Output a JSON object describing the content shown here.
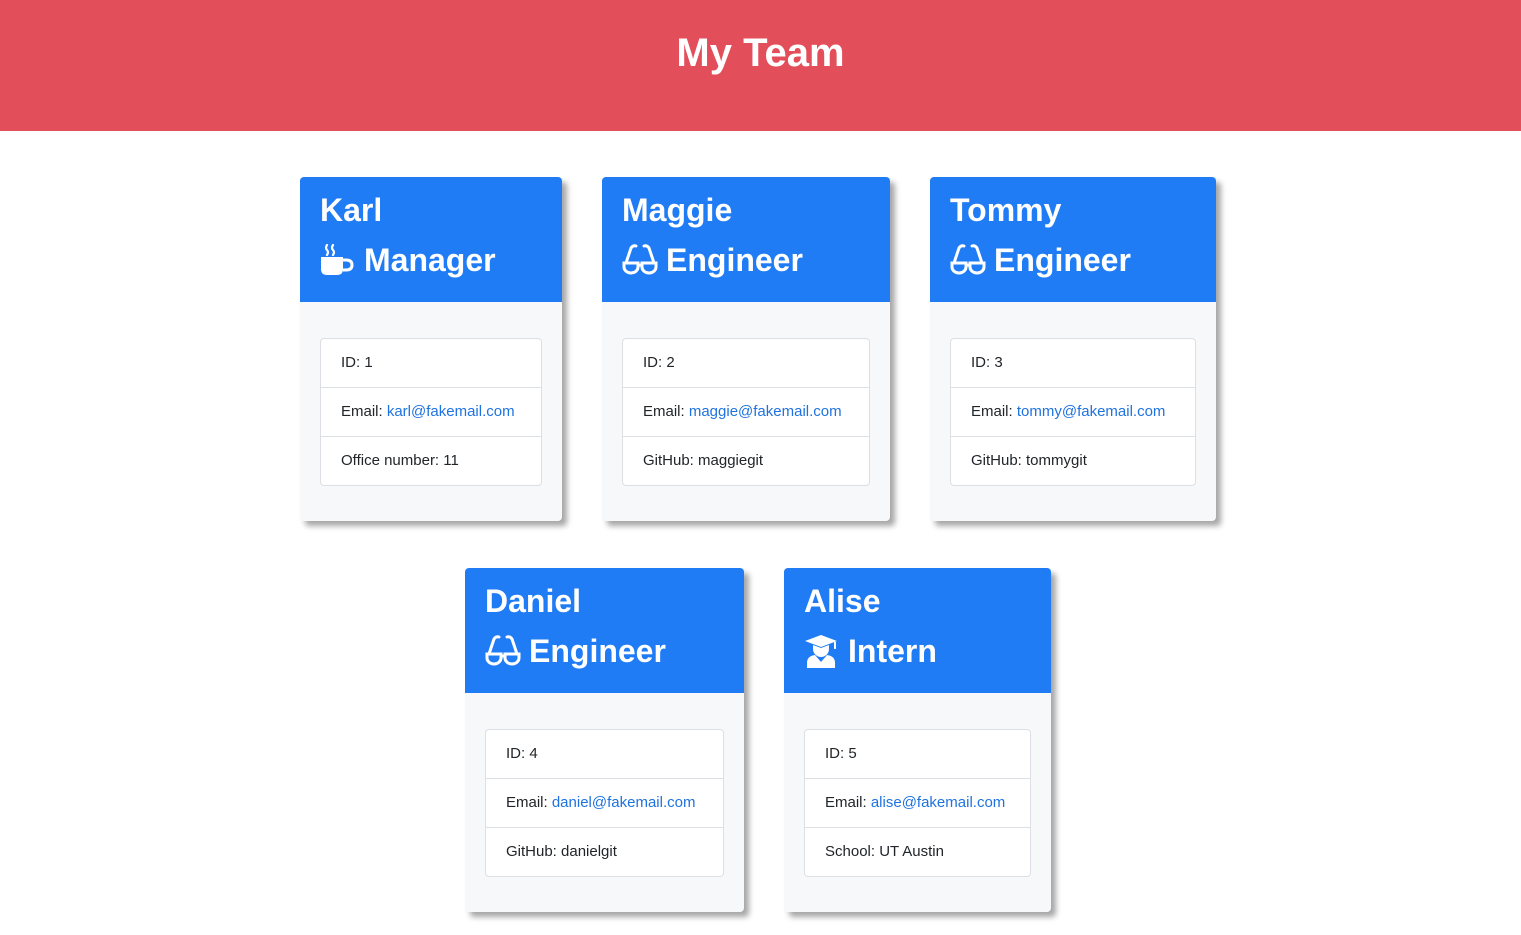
{
  "header": {
    "title": "My Team"
  },
  "employees": [
    {
      "name": "Karl",
      "role": "Manager",
      "role_icon": "coffee-icon",
      "id_label": "ID: 1",
      "email_label": "Email: ",
      "email": "karl@fakemail.com",
      "extra": "Office number: 11"
    },
    {
      "name": "Maggie",
      "role": "Engineer",
      "role_icon": "glasses-icon",
      "id_label": "ID: 2",
      "email_label": "Email: ",
      "email": "maggie@fakemail.com",
      "extra": "GitHub: maggiegit"
    },
    {
      "name": "Tommy",
      "role": "Engineer",
      "role_icon": "glasses-icon",
      "id_label": "ID: 3",
      "email_label": "Email: ",
      "email": "tommy@fakemail.com",
      "extra": "GitHub: tommygit"
    },
    {
      "name": "Daniel",
      "role": "Engineer",
      "role_icon": "glasses-icon",
      "id_label": "ID: 4",
      "email_label": "Email: ",
      "email": "daniel@fakemail.com",
      "extra": "GitHub: danielgit"
    },
    {
      "name": "Alise",
      "role": "Intern",
      "role_icon": "graduate-icon",
      "id_label": "ID: 5",
      "email_label": "Email: ",
      "email": "alise@fakemail.com",
      "extra": "School: UT Austin"
    }
  ],
  "colors": {
    "header_bg": "#e24e59",
    "card_header_bg": "#1f7cf5",
    "link": "#1f73e0"
  }
}
